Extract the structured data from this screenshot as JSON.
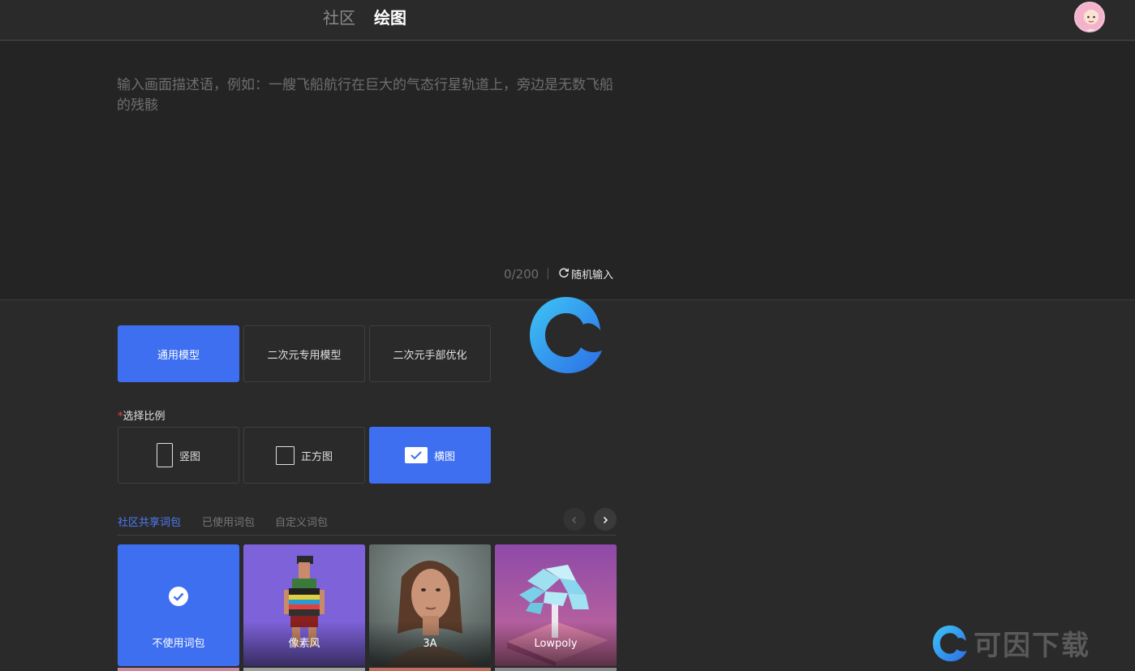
{
  "header": {
    "tabs": [
      "社区",
      "绘图"
    ],
    "active_tab": "绘图"
  },
  "prompt": {
    "placeholder": "输入画面描述语，例如：一艘飞船航行在巨大的气态行星轨道上，旁边是无数飞船的残骸",
    "value": "",
    "counter": "0/200",
    "separator": "|",
    "random_label": "随机输入"
  },
  "models": {
    "options": [
      "通用模型",
      "二次元专用模型",
      "二次元手部优化"
    ],
    "selected": "通用模型"
  },
  "ratio": {
    "required_mark": "*",
    "label": "选择比例",
    "options": [
      "竖图",
      "正方图",
      "横图"
    ],
    "selected": "横图"
  },
  "packs": {
    "tabs": [
      "社区共享词包",
      "已使用词包",
      "自定义词包"
    ],
    "active_tab": "社区共享词包",
    "items": [
      {
        "label": "不使用词包",
        "selected": true
      },
      {
        "label": "像素风",
        "selected": false
      },
      {
        "label": "3A",
        "selected": false
      },
      {
        "label": "Lowpoly",
        "selected": false
      }
    ]
  },
  "watermark": {
    "text": "可因下载"
  },
  "colors": {
    "accent": "#3d6ff0",
    "background": "#2a2a2a",
    "prompt_background": "#242424"
  }
}
